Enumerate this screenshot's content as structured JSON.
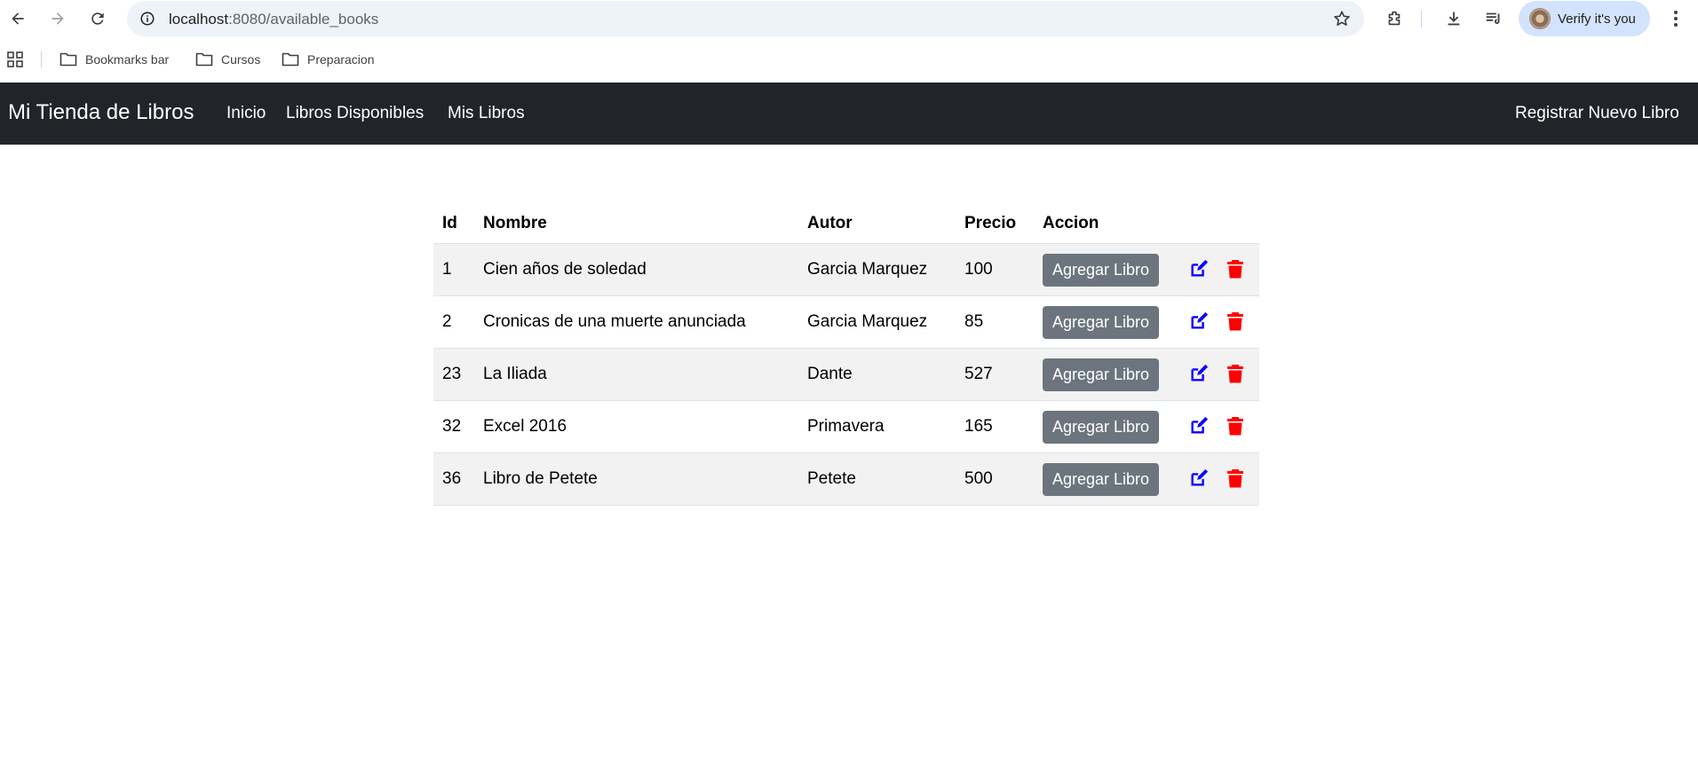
{
  "browser": {
    "url_host": "localhost",
    "url_path": ":8080/available_books",
    "profile_label": "Verify it's you",
    "bookmarks": [
      {
        "label": "Bookmarks bar"
      },
      {
        "label": "Cursos"
      },
      {
        "label": "Preparacion"
      }
    ]
  },
  "navbar": {
    "brand": "Mi Tienda de Libros",
    "links": [
      {
        "label": "Inicio"
      },
      {
        "label": "Libros Disponibles"
      },
      {
        "label": "Mis Libros"
      }
    ],
    "register_label": "Registrar Nuevo Libro"
  },
  "table": {
    "headers": [
      "Id",
      "Nombre",
      "Autor",
      "Precio",
      "Accion"
    ],
    "add_button_label": "Agregar Libro",
    "rows": [
      {
        "id": "1",
        "nombre": "Cien años de soledad",
        "autor": "Garcia Marquez",
        "precio": "100"
      },
      {
        "id": "2",
        "nombre": "Cronicas de una muerte anunciada",
        "autor": "Garcia Marquez",
        "precio": "85"
      },
      {
        "id": "23",
        "nombre": "La Iliada",
        "autor": "Dante",
        "precio": "527"
      },
      {
        "id": "32",
        "nombre": "Excel 2016",
        "autor": "Primavera",
        "precio": "165"
      },
      {
        "id": "36",
        "nombre": "Libro de Petete",
        "autor": "Petete",
        "precio": "500"
      }
    ]
  },
  "colors": {
    "navbar_bg": "#212529",
    "button_bg": "#6c757d",
    "edit_icon": "#0d00ff",
    "trash_icon": "#ff0000"
  },
  "icons": [
    "back-icon",
    "forward-icon",
    "reload-icon",
    "site-info-icon",
    "star-icon",
    "extensions-icon",
    "download-icon",
    "media-icon",
    "more-icon",
    "apps-icon",
    "folder-icon",
    "edit-icon",
    "trash-icon"
  ]
}
